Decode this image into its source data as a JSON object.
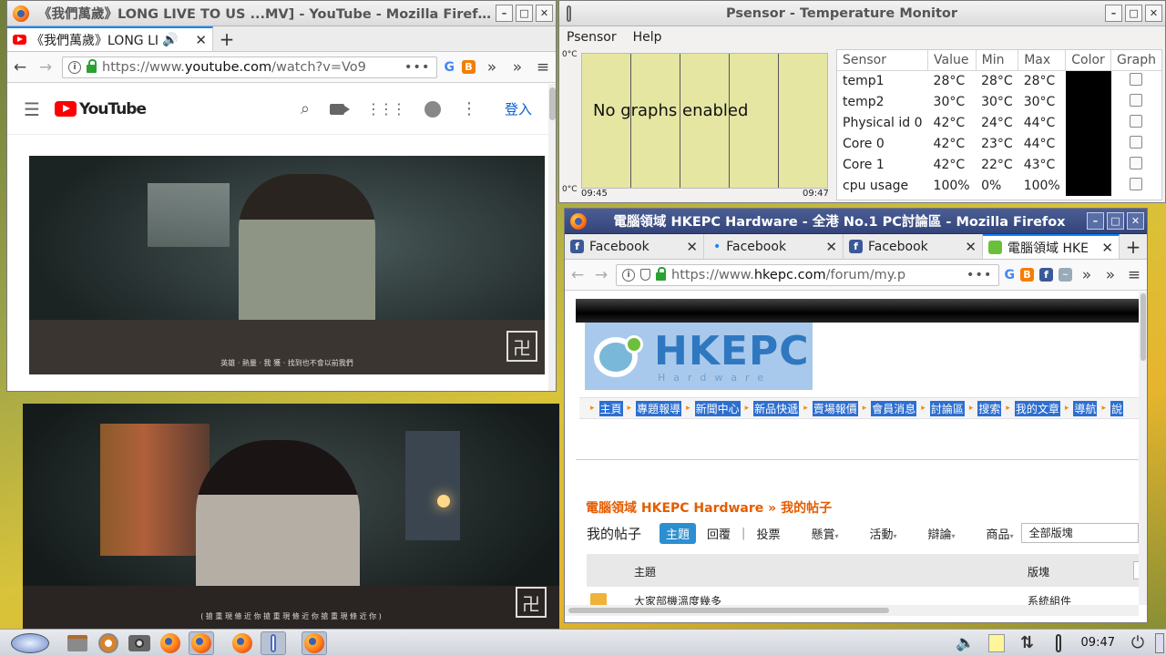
{
  "youtube_window": {
    "title": "《我們萬歲》LONG LIVE TO US ...MV] - YouTube - Mozilla Firefox",
    "tab_label": "《我們萬歲》LONG LI",
    "url_host_prefix": "https://www.",
    "url_domain": "youtube.com",
    "url_path": "/watch?v=Vo9",
    "logo_text": "YouTube",
    "login_label": "登入",
    "subtitle_1": "英雄 · 熱量 · 我 獲 · 找到也不會以前我們",
    "subtitle_2": "( 搶 重 現 條 近 你    搶 重 現 條 近 你    搶 重 現 條 近 你 )"
  },
  "psensor_window": {
    "title": "Psensor - Temperature Monitor",
    "menu": [
      "Psensor",
      "Help"
    ],
    "graph_y_top": "0°C",
    "graph_y_bottom": "0°C",
    "graph_x_start": "09:45",
    "graph_x_end": "09:47",
    "graph_message": "No graphs enabled",
    "columns": [
      "Sensor",
      "Value",
      "Min",
      "Max",
      "Color",
      "Graph"
    ],
    "rows": [
      {
        "sensor": "temp1",
        "value": "28°C",
        "min": "28°C",
        "max": "28°C"
      },
      {
        "sensor": "temp2",
        "value": "30°C",
        "min": "30°C",
        "max": "30°C"
      },
      {
        "sensor": "Physical id 0",
        "value": "42°C",
        "min": "24°C",
        "max": "44°C"
      },
      {
        "sensor": "Core 0",
        "value": "42°C",
        "min": "23°C",
        "max": "44°C"
      },
      {
        "sensor": "Core 1",
        "value": "42°C",
        "min": "22°C",
        "max": "43°C"
      },
      {
        "sensor": "cpu usage",
        "value": "100%",
        "min": "0%",
        "max": "100%"
      }
    ],
    "sensor_color": "#000000"
  },
  "hkepc_window": {
    "title": "電腦領域 HKEPC Hardware - 全港 No.1 PC討論區 - Mozilla Firefox",
    "tabs": [
      {
        "label": "Facebook"
      },
      {
        "label": "Facebook"
      },
      {
        "label": "Facebook"
      },
      {
        "label": "電腦領域 HKE"
      }
    ],
    "url_host_prefix": "https://www.",
    "url_domain": "hkepc.com",
    "url_path": "/forum/my.p",
    "logo_text": "HKEPC",
    "logo_sub": "Hardware",
    "nav": [
      "主頁",
      "專題報導",
      "新聞中心",
      "新品快遞",
      "賣場報價",
      "會員消息",
      "討論區",
      "搜索",
      "我的文章",
      "導航",
      "說"
    ],
    "breadcrumb": "電腦領域 HKEPC Hardware » 我的帖子",
    "section_title": "我的帖子",
    "filters": {
      "topic": "主題",
      "reply": "回覆",
      "vote": "投票",
      "reward": "懸賞",
      "activity": "活動",
      "debate": "辯論",
      "goods": "商品"
    },
    "forum_select": "全部版塊",
    "table_header_topic": "主題",
    "table_header_forum": "版塊",
    "row1_topic": "大家部機溫度幾多",
    "row1_forum": "系統組件"
  },
  "taskbar": {
    "clock": "09:47"
  }
}
